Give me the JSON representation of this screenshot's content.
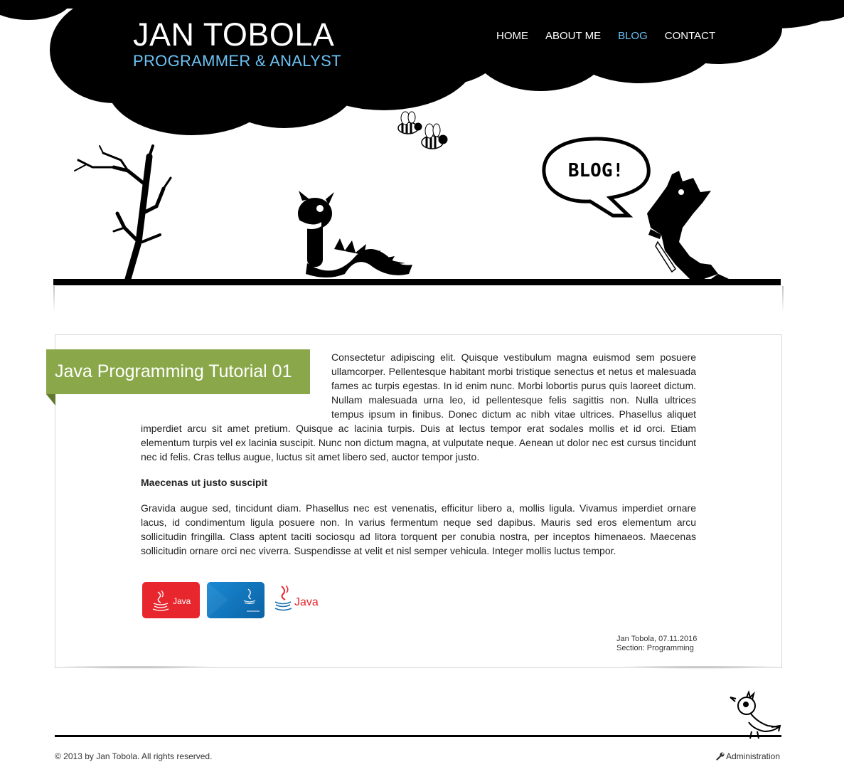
{
  "header": {
    "title": "JAN TOBOLA",
    "subtitle": "PROGRAMMER & ANALYST"
  },
  "nav": {
    "items": [
      {
        "label": "HOME"
      },
      {
        "label": "ABOUT ME"
      },
      {
        "label": "BLOG"
      },
      {
        "label": "CONTACT"
      }
    ],
    "active": "BLOG"
  },
  "scene": {
    "speech_bubble": "BLOG!"
  },
  "article": {
    "title": "Java Programming Tutorial 01",
    "paragraph1": "Consectetur adipiscing elit. Quisque vestibulum magna euismod sem posuere ullamcorper. Pellentesque habitant morbi tristique senectus et netus et malesuada fames ac turpis egestas. In id enim nunc. Morbi lobortis purus quis laoreet dictum. Nullam malesuada urna leo, id pellentesque felis sagittis non. Nulla ultrices tempus ipsum in finibus. Donec dictum ac nibh vitae ultrices. Phasellus aliquet imperdiet arcu sit amet pretium. Quisque ac lacinia turpis. Duis at lectus tempor erat sodales mollis et id orci. Etiam elementum turpis vel ex lacinia suscipit. Nunc non dictum magna, at vulputate neque. Aenean ut dolor nec est cursus tincidunt nec id felis. Cras tellus augue, luctus sit amet libero sed, auctor tempor justo.",
    "subheading": "Maecenas ut justo suscipit",
    "paragraph2": "Gravida augue sed, tincidunt diam. Phasellus nec est venenatis, efficitur libero a, mollis ligula. Vivamus imperdiet ornare lacus, id condimentum ligula posuere non. In varius fermentum neque sed dapibus. Mauris sed eros elementum arcu sollicitudin fringilla. Class aptent taciti sociosqu ad litora torquent per conubia nostra, per inceptos himenaeos. Maecenas sollicitudin ornare orci nec viverra. Suspendisse at velit et nisl semper vehicula. Integer mollis luctus tempor.",
    "badges": [
      {
        "icon": "java-logo-red-icon",
        "label": "Java"
      },
      {
        "icon": "java-logo-blue-icon",
        "label": ""
      },
      {
        "icon": "java-logo-plain-icon",
        "label": "Java"
      }
    ],
    "meta_author_date": "Jan Tobola, 07.11.2016",
    "meta_section": "Section: Programming"
  },
  "footer": {
    "copyright": "© 2013 by Jan Tobola. All rights reserved.",
    "admin_label": "Administration"
  },
  "colors": {
    "accent_blue": "#6cc2f4",
    "ribbon_green": "#8aa849",
    "badge_red": "#e8262d",
    "badge_blue": "#1a8ad4"
  }
}
